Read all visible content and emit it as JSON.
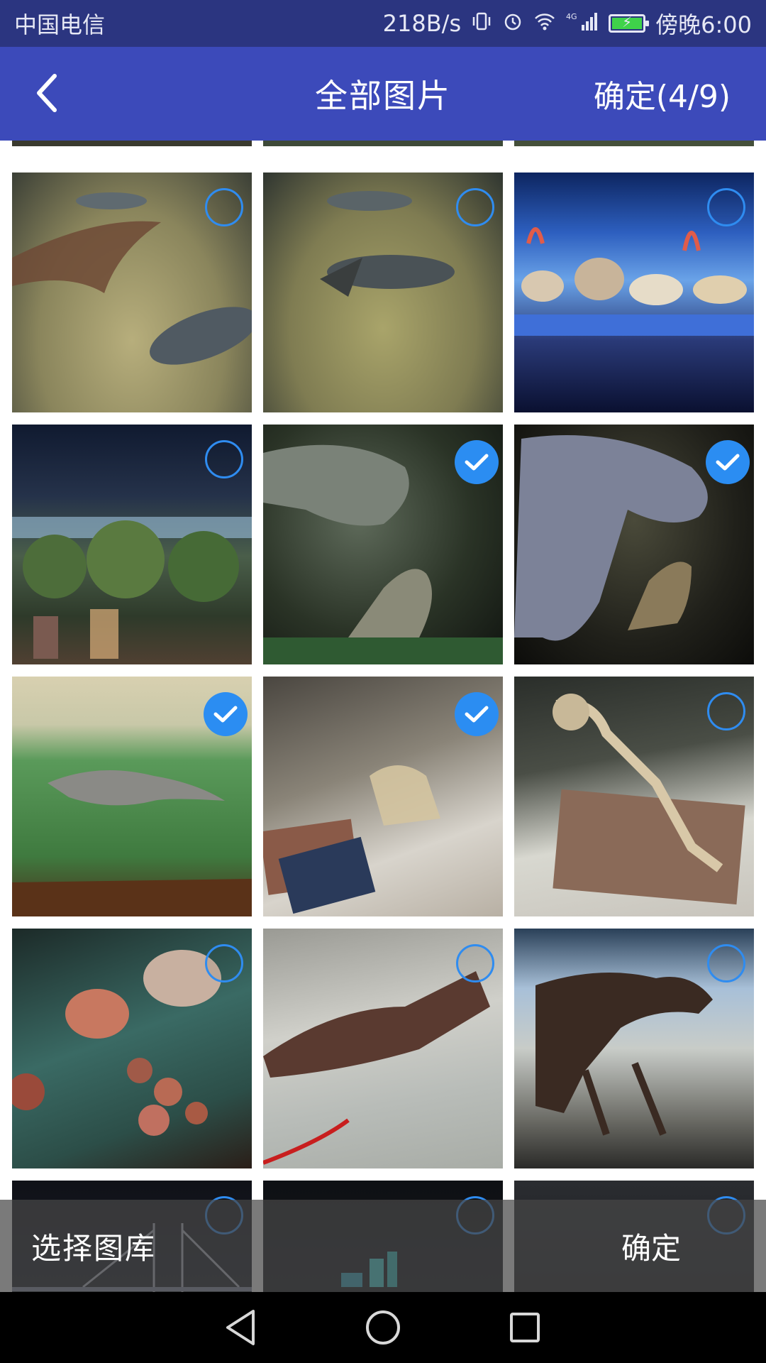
{
  "status_bar": {
    "carrier": "中国电信",
    "speed": "218B/s",
    "network": "4G",
    "time": "傍晚6:00"
  },
  "header": {
    "title": "全部图片",
    "confirm_label": "确定(4/9)"
  },
  "bottom_bar": {
    "select_gallery_label": "选择图库",
    "confirm_label": "确定"
  },
  "grid": {
    "selected_count": 4,
    "max_count": 9,
    "tiles": [
      {
        "subject": "sturgeon-fish-tank",
        "selected": false
      },
      {
        "subject": "fish-tank-sand",
        "selected": false
      },
      {
        "subject": "seashell-display",
        "selected": false
      },
      {
        "subject": "mangrove-diorama",
        "selected": false
      },
      {
        "subject": "dinosaur-model-dark",
        "selected": true
      },
      {
        "subject": "dinosaur-model-large",
        "selected": true
      },
      {
        "subject": "lizard-diorama",
        "selected": true
      },
      {
        "subject": "small-skeleton-case",
        "selected": true
      },
      {
        "subject": "upright-skeleton",
        "selected": false
      },
      {
        "subject": "dinosaur-eggs",
        "selected": false
      },
      {
        "subject": "crocodile-skeleton",
        "selected": false
      },
      {
        "subject": "hall-skeletons",
        "selected": false
      },
      {
        "subject": "night-bridge",
        "selected": false
      },
      {
        "subject": "night-city",
        "selected": false
      },
      {
        "subject": "night-sky",
        "selected": false
      }
    ]
  },
  "colors": {
    "status_bar": "#2b3580",
    "header": "#3c4aba",
    "accent": "#2b8df2"
  }
}
